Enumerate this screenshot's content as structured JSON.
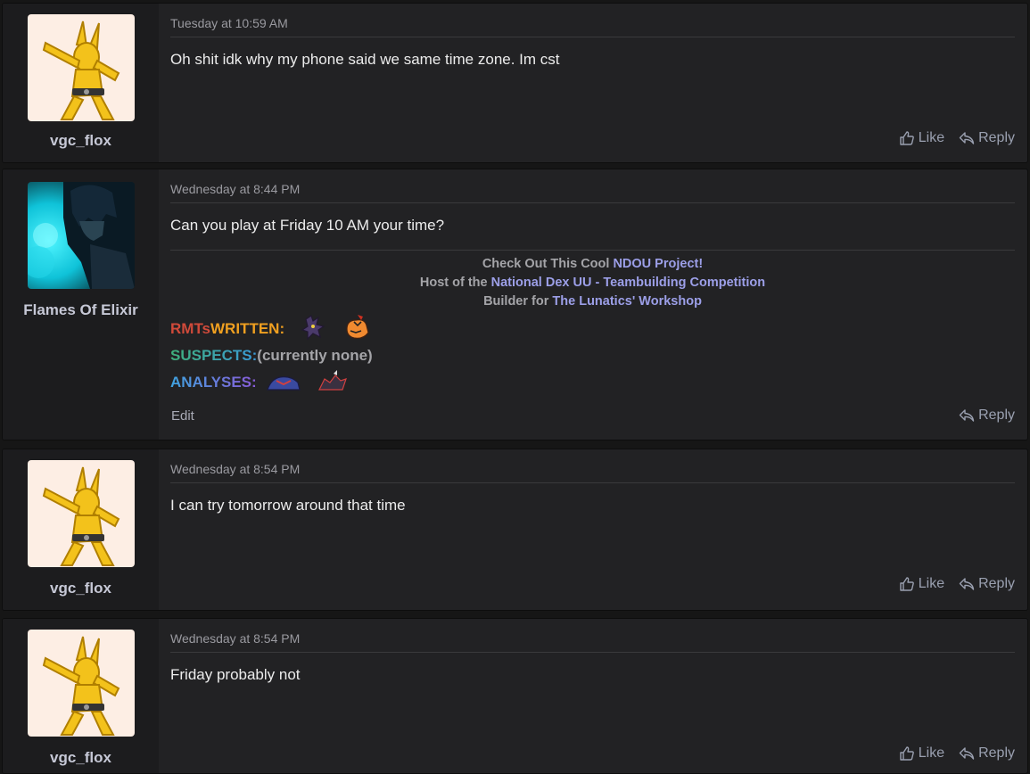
{
  "posts": [
    {
      "username": "vgc_flox",
      "date": "Tuesday at 10:59 AM",
      "body": "Oh shit idk why my phone said we same time zone. Im cst",
      "like_label": "Like",
      "reply_label": "Reply"
    },
    {
      "username": "Flames Of Elixir",
      "date": "Wednesday at 8:44 PM",
      "body": "Can you play at Friday 10 AM your time?",
      "edit_label": "Edit",
      "reply_label": "Reply",
      "signature": {
        "line1_prefix": "Check Out This Cool ",
        "line1_link": "NDOU Project!",
        "line2_prefix": "Host of the ",
        "line2_link": "National Dex UU - Teambuilding Competition",
        "line3_prefix": "Builder for ",
        "line3_link": "The Lunatics' Workshop",
        "rmts_a": "RMTs",
        "rmts_b": " WRITTEN:",
        "suspects_label": "SUSPECTS:",
        "suspects_value": " (currently none)",
        "analyses_label": "ANALYSES:"
      }
    },
    {
      "username": "vgc_flox",
      "date": "Wednesday at 8:54 PM",
      "body": "I can try tomorrow around that time",
      "like_label": "Like",
      "reply_label": "Reply"
    },
    {
      "username": "vgc_flox",
      "date": "Wednesday at 8:54 PM",
      "body": "Friday probably not",
      "like_label": "Like",
      "reply_label": "Reply"
    }
  ],
  "colors": {
    "link": "#9c9fe8",
    "rmts_red": "#d04a3a",
    "rmts_orange": "#f0a020",
    "suspects_green": "#3fb07a",
    "suspects_blue": "#3a9ad8",
    "analyses_blue": "#3fa4e0",
    "analyses_purple": "#8a5ad8"
  },
  "icons": [
    "thumbs-up-icon",
    "reply-icon"
  ]
}
